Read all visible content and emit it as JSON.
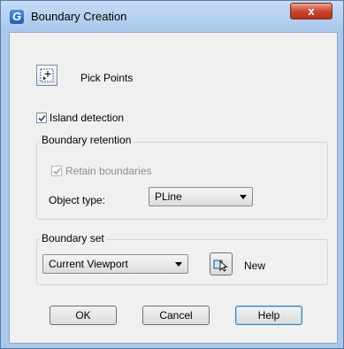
{
  "window": {
    "title": "Boundary Creation",
    "app_icon_glyph": "G",
    "close_glyph": "x",
    "accent": "#a9c8ea"
  },
  "pick_points": {
    "label": "Pick Points",
    "icon": "pick-points-icon"
  },
  "island_detection": {
    "label": "Island detection",
    "checked": true
  },
  "boundary_retention": {
    "legend": "Boundary retention",
    "retain": {
      "label": "Retain boundaries",
      "checked": true,
      "enabled": false
    },
    "object_type": {
      "label": "Object type:",
      "value": "PLine"
    }
  },
  "boundary_set": {
    "legend": "Boundary set",
    "selection": "Current Viewport",
    "new_label": "New",
    "new_icon": "select-objects-icon"
  },
  "buttons": {
    "ok": "OK",
    "cancel": "Cancel",
    "help": "Help"
  }
}
